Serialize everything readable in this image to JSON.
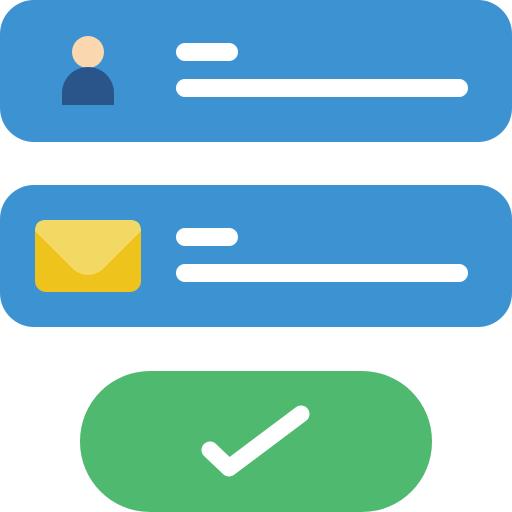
{
  "colors": {
    "card": "#3d93d2",
    "line": "#ffffff",
    "avatar_head": "#fbd7b0",
    "avatar_body": "#29558a",
    "envelope_body": "#eec41c",
    "envelope_flap": "#f3d863",
    "button": "#4fb96f",
    "check": "#ffffff"
  },
  "cards": [
    {
      "id": "name-field",
      "icon": "user-icon"
    },
    {
      "id": "email-field",
      "icon": "envelope-icon"
    }
  ],
  "submit": {
    "icon": "check-icon"
  }
}
